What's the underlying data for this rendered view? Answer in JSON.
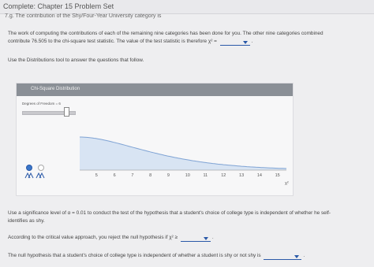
{
  "header": {
    "title": "Complete: Chapter 15 Problem Set"
  },
  "cutoff_line": "7.g. The contribution of the Shy/Four-Year University category is",
  "paragraph1": {
    "line1": "The work of computing the contributions of each of the remaining nine categories has been done for you. The other nine categories combined",
    "line2_pre": "contribute 76.505 to the chi-square test statistic. The value of the test statistic is therefore χ² =",
    "line2_post": "."
  },
  "instruction": "Use the Distributions tool to answer the questions that follow.",
  "tool": {
    "title": "Chi-Square Distribution",
    "dof_label": "Degrees of Freedom = 6",
    "dof_value": 6,
    "x_ticks": [
      "5",
      "6",
      "7",
      "8",
      "9",
      "10",
      "11",
      "12",
      "13",
      "14",
      "15"
    ],
    "x_axis_symbol": "χ²"
  },
  "question1": {
    "line1": "Use a significance level of α = 0.01 to conduct the test of the hypothesis that a student's choice of college type is independent of whether he self-",
    "line2": "identifies as shy."
  },
  "question2": {
    "pre": "According to the critical value approach, you reject the null hypothesis if χ² ≥",
    "post": "."
  },
  "question3": {
    "pre": "The null hypothesis that a student's choice of college type is independent of whether a student is shy or not shy is",
    "post": "."
  },
  "colors": {
    "accent": "#2a59a8",
    "curve_fill": "#d8e4f3",
    "curve_stroke": "#7fa3d4",
    "header": "#8a8f96"
  }
}
